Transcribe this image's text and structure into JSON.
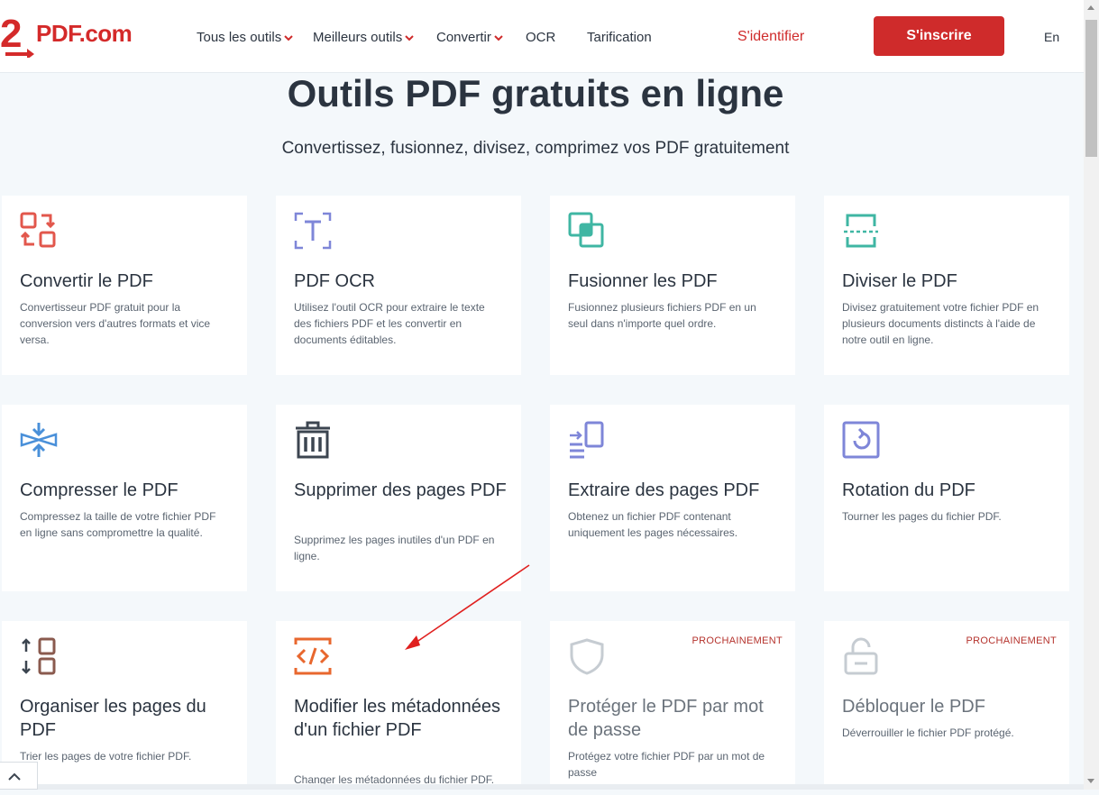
{
  "brand": {
    "logo_text": "PDF.com",
    "logo_digit": "2",
    "accent": "#cf2b2b"
  },
  "nav": {
    "items": [
      {
        "label": "Tous les outils",
        "has_chevron": true
      },
      {
        "label": "Meilleurs outils",
        "has_chevron": true
      },
      {
        "label": "Convertir",
        "has_chevron": true
      },
      {
        "label": "OCR",
        "has_chevron": false
      },
      {
        "label": "Tarification",
        "has_chevron": false
      }
    ],
    "login": "S'identifier",
    "signup": "S'inscrire",
    "lang": "En"
  },
  "hero": {
    "title": "Outils PDF gratuits en ligne",
    "subtitle": "Convertissez, fusionnez, divisez, comprimez vos PDF gratuitement"
  },
  "cards": [
    {
      "icon": "convert-icon",
      "title": "Convertir le PDF",
      "desc": "Convertisseur PDF gratuit pour la conversion vers d'autres formats et vice versa.",
      "badge": ""
    },
    {
      "icon": "ocr-icon",
      "title": "PDF OCR",
      "desc": "Utilisez l'outil OCR pour extraire le texte des fichiers PDF et les convertir en documents éditables.",
      "badge": ""
    },
    {
      "icon": "merge-icon",
      "title": "Fusionner les PDF",
      "desc": "Fusionnez plusieurs fichiers PDF en un seul dans n'importe quel ordre.",
      "badge": ""
    },
    {
      "icon": "split-icon",
      "title": "Diviser le PDF",
      "desc": "Divisez gratuitement votre fichier PDF en plusieurs documents distincts à l'aide de notre outil en ligne.",
      "badge": ""
    },
    {
      "icon": "compress-icon",
      "title": "Compresser le PDF",
      "desc": "Compressez la taille de votre fichier PDF en ligne sans compromettre la qualité.",
      "badge": ""
    },
    {
      "icon": "trash-icon",
      "title": "Supprimer des pages PDF",
      "desc": "Supprimez les pages inutiles d'un PDF en ligne.",
      "badge": ""
    },
    {
      "icon": "extract-icon",
      "title": "Extraire des pages PDF",
      "desc": "Obtenez un fichier PDF contenant uniquement les pages nécessaires.",
      "badge": ""
    },
    {
      "icon": "rotate-icon",
      "title": "Rotation du PDF",
      "desc": "Tourner les pages du fichier PDF.",
      "badge": ""
    },
    {
      "icon": "organize-icon",
      "title": "Organiser les pages du PDF",
      "desc": "Trier les pages de votre fichier PDF.",
      "badge": ""
    },
    {
      "icon": "code-icon",
      "title": "Modifier les métadonnées d'un fichier PDF",
      "desc": "Changer les métadonnées du fichier PDF.",
      "badge": ""
    },
    {
      "icon": "shield-icon",
      "title": "Protéger le PDF par mot de passe",
      "desc": "Protégez votre fichier PDF par un mot de passe",
      "badge": "PROCHAINEMENT"
    },
    {
      "icon": "unlock-icon",
      "title": "Débloquer le PDF",
      "desc": "Déverrouiller le fichier PDF protégé.",
      "badge": "PROCHAINEMENT"
    }
  ]
}
